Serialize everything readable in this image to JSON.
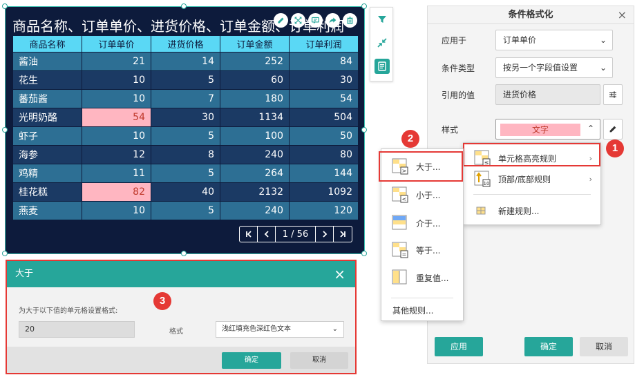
{
  "widget": {
    "title": "商品名称、订单单价、进货价格、订单金额、订单利润",
    "tools": [
      "edit-icon",
      "expand-icon",
      "comment-icon",
      "share-icon",
      "delete-icon"
    ],
    "table": {
      "headers": [
        "商品名称",
        "订单单价",
        "进货价格",
        "订单金额",
        "订单利润"
      ],
      "rows": [
        [
          "酱油",
          "21",
          "14",
          "252",
          "84"
        ],
        [
          "花生",
          "10",
          "5",
          "60",
          "30"
        ],
        [
          "蕃茄酱",
          "10",
          "7",
          "180",
          "54"
        ],
        [
          "光明奶酪",
          "54",
          "30",
          "1134",
          "504"
        ],
        [
          "虾子",
          "10",
          "5",
          "100",
          "50"
        ],
        [
          "海参",
          "12",
          "8",
          "240",
          "80"
        ],
        [
          "鸡精",
          "11",
          "5",
          "264",
          "144"
        ],
        [
          "桂花糕",
          "82",
          "40",
          "2132",
          "1092"
        ],
        [
          "燕麦",
          "10",
          "5",
          "240",
          "120"
        ]
      ],
      "highlighted_rows": [
        3,
        7
      ]
    },
    "pager": {
      "first": "|<",
      "prev": "<",
      "info": "1 / 56",
      "next": ">",
      "last": ">|"
    }
  },
  "side_toolbar": [
    "filter-icon",
    "shrink-icon",
    "conditional-format-icon"
  ],
  "panel": {
    "title": "条件格式化",
    "close": "×",
    "apply_to_label": "应用于",
    "apply_to_value": "订单单价",
    "condition_type_label": "条件类型",
    "condition_type_value": "按另一个字段值设置",
    "ref_value_label": "引用的值",
    "ref_value_value": "进货价格",
    "style_label": "样式",
    "style_sample": "文字",
    "apply_button": "应用",
    "ok_button": "确定",
    "cancel_button": "取消"
  },
  "rule_menu": {
    "items": [
      {
        "label": "单元格高亮规则",
        "arrow": "›"
      },
      {
        "label": "顶部/底部规则",
        "arrow": "›"
      },
      {
        "label": "新建规则..."
      }
    ]
  },
  "sub_menu": {
    "items": [
      "大于...",
      "小于...",
      "介于...",
      "等于...",
      "重复值..."
    ],
    "other": "其他规则..."
  },
  "badges": [
    "1",
    "2",
    "3"
  ],
  "dialog": {
    "title": "大于",
    "close": "×",
    "prompt": "为大于以下值的单元格设置格式:",
    "value": "20",
    "format_label": "格式",
    "format_value": "浅红填充色深红色文本",
    "ok": "确定",
    "cancel": "取消"
  },
  "colors": {
    "accent": "#26a69a",
    "highlight_bg": "#ffb6c1",
    "highlight_text": "#c0392b",
    "annotation_red": "#e53935"
  }
}
